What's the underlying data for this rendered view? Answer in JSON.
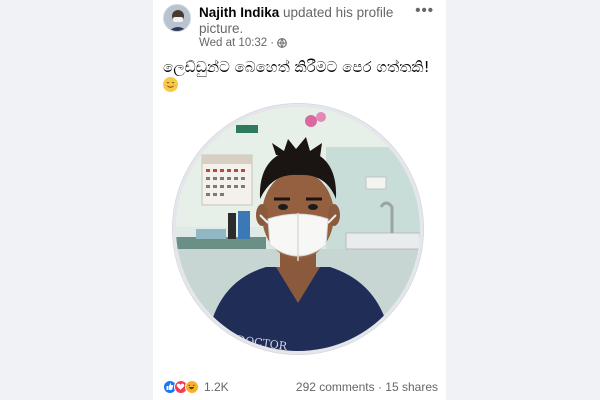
{
  "post": {
    "author": "Najith Indika",
    "action": "updated his profile picture.",
    "timestamp": "Wed at 10:32",
    "separator": "·",
    "privacy_icon": "globe-icon",
    "more_label": "•••",
    "caption": "ලෙඩ්ඩුන්ට බෙහෙත් කිරීමට පෙර ගත්තකි!",
    "caption_emoji": "smiling-face-icon"
  },
  "footer": {
    "reaction_icons": [
      "like-icon",
      "love-icon",
      "haha-icon"
    ],
    "reaction_count": "1.2K",
    "comments": "292 comments",
    "dot": "·",
    "shares": "15 shares"
  },
  "colors": {
    "like": "#1877f2",
    "love": "#f33e58",
    "haha": "#f7b125",
    "background": "#f0f2f5",
    "text_secondary": "#65676b"
  }
}
